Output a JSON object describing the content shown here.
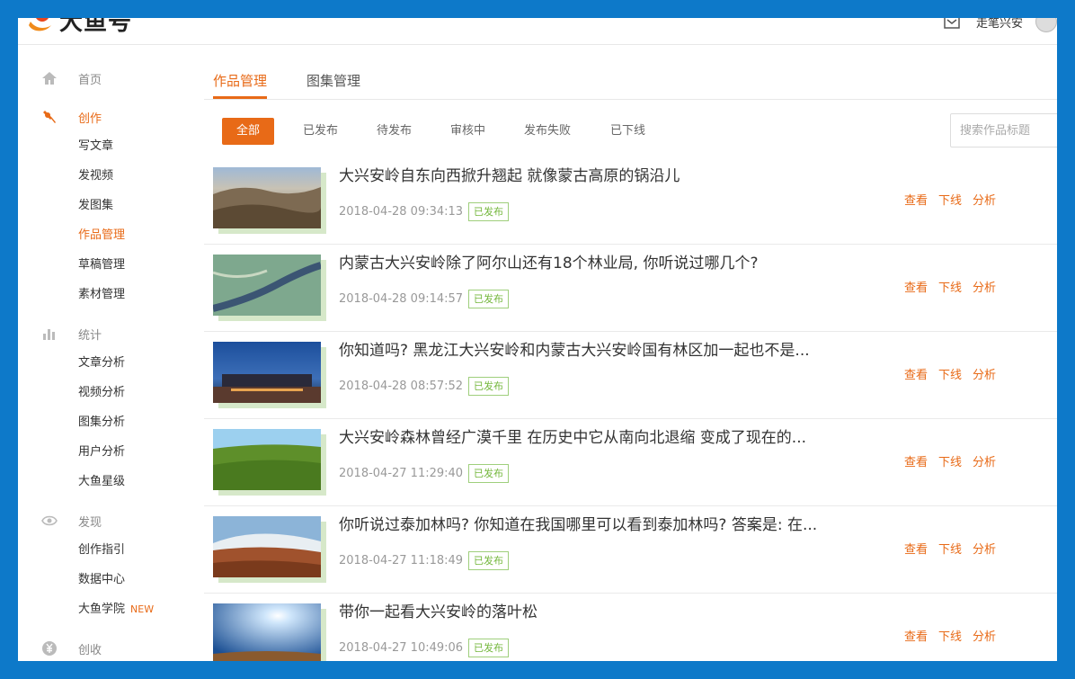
{
  "header": {
    "logo_text": "大鱼号",
    "username": "走笔兴安"
  },
  "sidebar": {
    "home": "首页",
    "create": {
      "label": "创作",
      "items": [
        "写文章",
        "发视频",
        "发图集",
        "作品管理",
        "草稿管理",
        "素材管理"
      ]
    },
    "stats": {
      "label": "统计",
      "items": [
        "文章分析",
        "视频分析",
        "图集分析",
        "用户分析",
        "大鱼星级"
      ]
    },
    "discover": {
      "label": "发现",
      "items": [
        "创作指引",
        "数据中心",
        "大鱼学院"
      ],
      "new_badge": "NEW"
    },
    "income": {
      "label": "创收"
    }
  },
  "tabs": [
    "作品管理",
    "图集管理"
  ],
  "filters": [
    "全部",
    "已发布",
    "待发布",
    "审核中",
    "发布失败",
    "已下线"
  ],
  "search": {
    "placeholder": "搜索作品标题"
  },
  "actions": {
    "view": "查看",
    "offline": "下线",
    "analyze": "分析"
  },
  "articles": [
    {
      "title": "大兴安岭自东向西掀升翘起 就像蒙古高原的锅沿儿",
      "time": "2018-04-28 09:34:13",
      "status": "已发布"
    },
    {
      "title": "内蒙古大兴安岭除了阿尔山还有18个林业局, 你听说过哪几个?",
      "time": "2018-04-28 09:14:57",
      "status": "已发布"
    },
    {
      "title": "你知道吗? 黑龙江大兴安岭和内蒙古大兴安岭国有林区加一起也不是...",
      "time": "2018-04-28 08:57:52",
      "status": "已发布"
    },
    {
      "title": "大兴安岭森林曾经广漠千里 在历史中它从南向北退缩 变成了现在的...",
      "time": "2018-04-27 11:29:40",
      "status": "已发布"
    },
    {
      "title": "你听说过泰加林吗? 你知道在我国哪里可以看到泰加林吗? 答案是: 在...",
      "time": "2018-04-27 11:18:49",
      "status": "已发布"
    },
    {
      "title": "带你一起看大兴安岭的落叶松",
      "time": "2018-04-27 10:49:06",
      "status": "已发布"
    }
  ],
  "colors": {
    "accent": "#e86a17",
    "published": "#74b73c",
    "frame": "#0d79c9"
  }
}
